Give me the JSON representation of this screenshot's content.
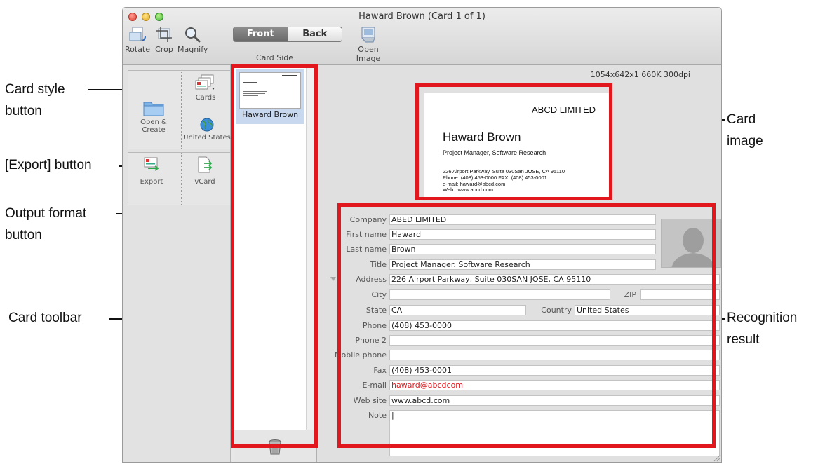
{
  "window": {
    "title": "Haward Brown (Card 1 of 1)"
  },
  "toolbar": {
    "rotate": "Rotate",
    "crop": "Crop",
    "magnify": "Magnify",
    "front": "Front",
    "back": "Back",
    "card_side": "Card Side",
    "open_image": "Open Image"
  },
  "sidebar": {
    "open_create": "Open &\nCreate",
    "cards": "Cards",
    "region": "United States",
    "export": "Export",
    "vcard": "vCard"
  },
  "card_list": {
    "name": "Haward Brown"
  },
  "image_info": "1054x642x1  660K  300dpi",
  "card_image": {
    "company": "ABCD LIMITED",
    "name": "Haward Brown",
    "title": "Project Manager, Software Research",
    "address": "226 Airport Parkway, Suite 030San JOSE, CA 95110",
    "phones": "Phone: (408) 453-0000     FAX: (408) 453-0001",
    "email": "e-mail: haward@abcd.com",
    "web": "Web   : www.abcd.com"
  },
  "fields": {
    "company": {
      "label": "Company",
      "value": "ABED LIMITED"
    },
    "first_name": {
      "label": "First name",
      "value": "Haward"
    },
    "last_name": {
      "label": "Last name",
      "value": "Brown"
    },
    "title": {
      "label": "Title",
      "value": "Project Manager. Software Research"
    },
    "address": {
      "label": "Address",
      "value": "226 Airport Parkway, Suite 030SAN JOSE, CA 95110"
    },
    "city": {
      "label": "City",
      "value": ""
    },
    "zip": {
      "label": "ZIP",
      "value": ""
    },
    "state": {
      "label": "State",
      "value": "CA"
    },
    "country": {
      "label": "Country",
      "value": "United States"
    },
    "phone": {
      "label": "Phone",
      "value": "(408) 453-0000"
    },
    "phone2": {
      "label": "Phone 2",
      "value": ""
    },
    "mobile": {
      "label": "Mobile phone",
      "value": ""
    },
    "fax": {
      "label": "Fax",
      "value": "(408) 453-0001"
    },
    "email": {
      "label": "E-mail",
      "value": "haward@abcdcom"
    },
    "website": {
      "label": "Web site",
      "value": "www.abcd.com"
    },
    "note": {
      "label": "Note",
      "value": "|"
    }
  },
  "callouts": {
    "card_style_1": "Card style",
    "card_style_2": "button",
    "export_button": "[Export] button",
    "output_format_1": "Output format",
    "output_format_2": "button",
    "card_toolbar": "Card toolbar",
    "card_image_1": "Card",
    "card_image_2": "image",
    "recognition_1": "Recognition",
    "recognition_2": "result"
  },
  "colors": {
    "highlight": "#e2171d",
    "email_text": "#e2171d",
    "selection": "#c8d9ef"
  }
}
